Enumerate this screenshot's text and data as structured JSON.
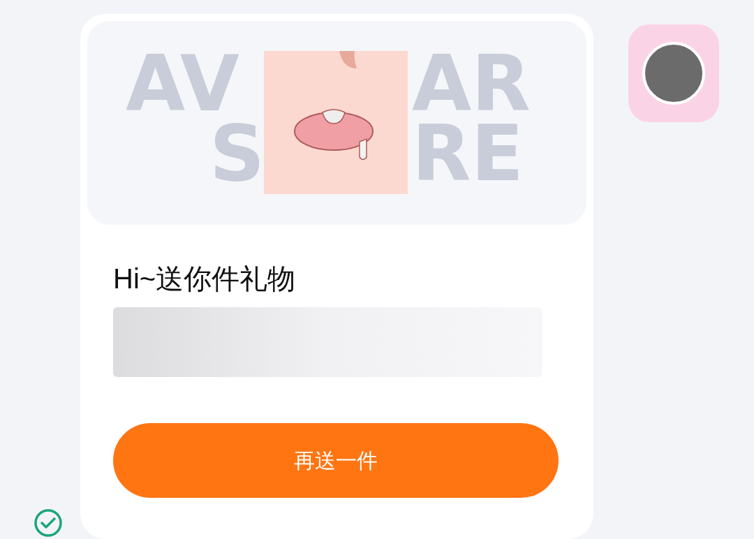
{
  "gift_card": {
    "banner_text": [
      "AV",
      "AR",
      "S",
      "RE"
    ],
    "title": "Hi~送你件礼物",
    "button": "再送一件"
  },
  "message_status": {
    "delivered": true
  }
}
